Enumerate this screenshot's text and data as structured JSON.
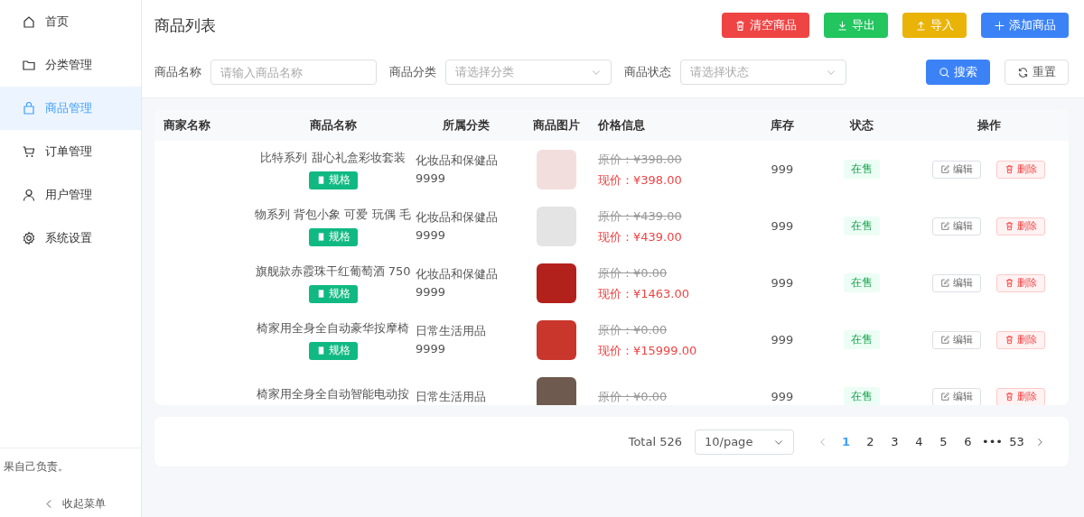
{
  "sidebar": {
    "items": [
      {
        "label": "首页",
        "selected": false
      },
      {
        "label": "分类管理",
        "selected": false
      },
      {
        "label": "商品管理",
        "selected": true
      },
      {
        "label": "订单管理",
        "selected": false
      },
      {
        "label": "用户管理",
        "selected": false
      },
      {
        "label": "系统设置",
        "selected": false
      }
    ],
    "notice": "果自己负责。",
    "collapse": "收起菜单"
  },
  "page_title": "商品列表",
  "actions": [
    {
      "label": "清空商品",
      "kind": "danger"
    },
    {
      "label": "导出",
      "kind": "success"
    },
    {
      "label": "导入",
      "kind": "warning"
    },
    {
      "label": "添加商品",
      "kind": "primary"
    }
  ],
  "filters": [
    {
      "label": "商品名称",
      "kind": "input",
      "placeholder": "请输入商品名称"
    },
    {
      "label": "商品分类",
      "kind": "select",
      "placeholder": "请选择分类"
    },
    {
      "label": "商品状态",
      "kind": "select",
      "placeholder": "请选择状态"
    }
  ],
  "search_button": "搜索",
  "reset_button": "重置",
  "table": {
    "columns": [
      "商家名称",
      "商品名称",
      "所属分类",
      "商品图片",
      "价格信息",
      "库存",
      "状态",
      "操作"
    ],
    "rows": [
      {
        "name": "比特系列 甜心礼盒彩妆套装",
        "spec": "规格",
        "category": "化妆品和保健品",
        "category_code": "9999",
        "original_price": "原价：¥398.00",
        "current_price": "现价：¥398.00",
        "stock": "999",
        "status": "在售",
        "edit": "编辑",
        "delete": "删除"
      },
      {
        "name": "物系列 背包小象 可爱 玩偶 毛",
        "spec": "规格",
        "category": "化妆品和保健品",
        "category_code": "9999",
        "original_price": "原价：¥439.00",
        "current_price": "现价：¥439.00",
        "stock": "999",
        "status": "在售",
        "edit": "编辑",
        "delete": "删除"
      },
      {
        "name": "旗舰款赤霞珠干红葡萄酒 750",
        "spec": "规格",
        "category": "化妆品和保健品",
        "category_code": "9999",
        "original_price": "原价：¥0.00",
        "current_price": "现价：¥1463.00",
        "stock": "999",
        "status": "在售",
        "edit": "编辑",
        "delete": "删除"
      },
      {
        "name": "椅家用全身全自动豪华按摩椅",
        "spec": "规格",
        "category": "日常生活用品",
        "category_code": "9999",
        "original_price": "原价：¥0.00",
        "current_price": "现价：¥15999.00",
        "stock": "999",
        "status": "在售",
        "edit": "编辑",
        "delete": "删除"
      },
      {
        "name": "椅家用全身全自动智能电动按",
        "category": "日常生活用品",
        "original_price": "原价：¥0.00",
        "stock": "999",
        "status": "在售",
        "edit": "编辑",
        "delete": "删除"
      }
    ]
  },
  "pagination": {
    "total": "Total 526",
    "page_size": "10/page",
    "pages": [
      {
        "label": "1",
        "selected": true
      },
      {
        "label": "2",
        "selected": false
      },
      {
        "label": "3",
        "selected": false
      },
      {
        "label": "4",
        "selected": false
      },
      {
        "label": "5",
        "selected": false
      },
      {
        "label": "6",
        "selected": false
      },
      {
        "label": "•••",
        "selected": false
      },
      {
        "label": "53",
        "selected": false
      }
    ]
  }
}
